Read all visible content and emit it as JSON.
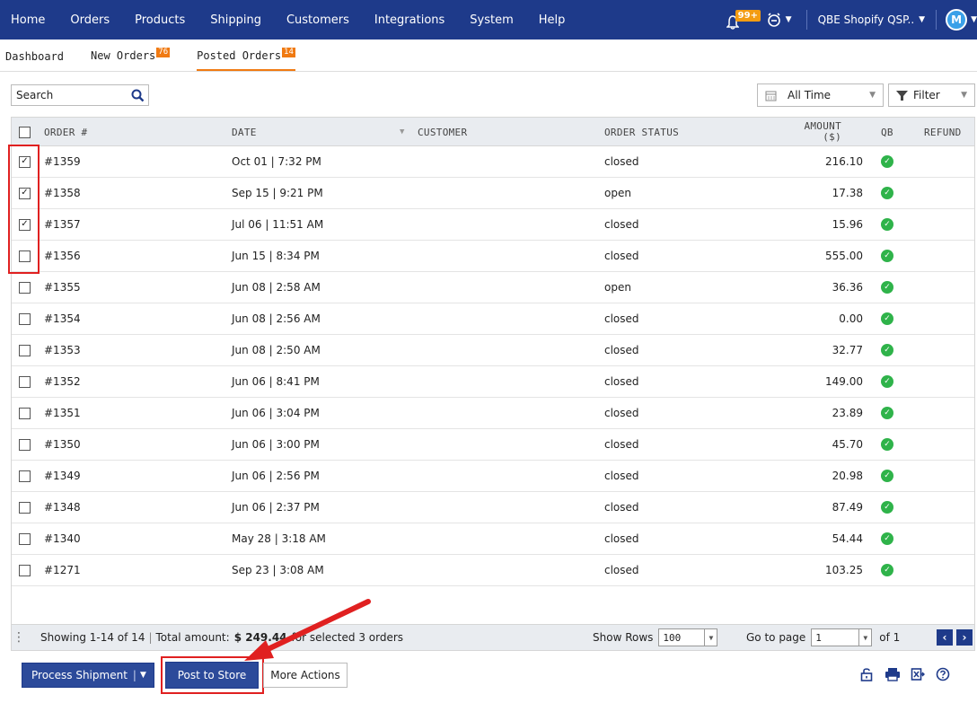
{
  "topnav": {
    "items": [
      "Home",
      "Orders",
      "Products",
      "Shipping",
      "Customers",
      "Integrations",
      "System",
      "Help"
    ],
    "notification_count": "99+",
    "store_name": "QBE Shopify QSP..",
    "avatar_initial": "M"
  },
  "subtabs": [
    {
      "label": "Dashboard",
      "count": ""
    },
    {
      "label": "New Orders",
      "count": "76"
    },
    {
      "label": "Posted Orders",
      "count": "14"
    }
  ],
  "toolbar": {
    "search_placeholder": "Search",
    "date_range": "All Time",
    "filter_label": "Filter"
  },
  "table": {
    "headers": {
      "order": "ORDER #",
      "date": "DATE",
      "customer": "CUSTOMER",
      "status": "ORDER STATUS",
      "amount_line1": "AMOUNT",
      "amount_line2": "($)",
      "qb": "QB",
      "refund": "REFUND"
    },
    "rows": [
      {
        "order": "#1359",
        "date": "Oct 01 | 7:32 PM",
        "customer": "",
        "status": "closed",
        "amount": "216.10",
        "checked": true
      },
      {
        "order": "#1358",
        "date": "Sep 15 | 9:21 PM",
        "customer": "",
        "status": "open",
        "amount": "17.38",
        "checked": true
      },
      {
        "order": "#1357",
        "date": "Jul 06 | 11:51 AM",
        "customer": "",
        "status": "closed",
        "amount": "15.96",
        "checked": true
      },
      {
        "order": "#1356",
        "date": "Jun 15 | 8:34 PM",
        "customer": "",
        "status": "closed",
        "amount": "555.00",
        "checked": false
      },
      {
        "order": "#1355",
        "date": "Jun 08 | 2:58 AM",
        "customer": "",
        "status": "open",
        "amount": "36.36",
        "checked": false
      },
      {
        "order": "#1354",
        "date": "Jun 08 | 2:56 AM",
        "customer": "",
        "status": "closed",
        "amount": "0.00",
        "checked": false
      },
      {
        "order": "#1353",
        "date": "Jun 08 | 2:50 AM",
        "customer": "",
        "status": "closed",
        "amount": "32.77",
        "checked": false
      },
      {
        "order": "#1352",
        "date": "Jun 06 | 8:41 PM",
        "customer": "",
        "status": "closed",
        "amount": "149.00",
        "checked": false
      },
      {
        "order": "#1351",
        "date": "Jun 06 | 3:04 PM",
        "customer": "",
        "status": "closed",
        "amount": "23.89",
        "checked": false
      },
      {
        "order": "#1350",
        "date": "Jun 06 | 3:00 PM",
        "customer": "",
        "status": "closed",
        "amount": "45.70",
        "checked": false
      },
      {
        "order": "#1349",
        "date": "Jun 06 | 2:56 PM",
        "customer": "",
        "status": "closed",
        "amount": "20.98",
        "checked": false
      },
      {
        "order": "#1348",
        "date": "Jun 06 | 2:37 PM",
        "customer": "",
        "status": "closed",
        "amount": "87.49",
        "checked": false
      },
      {
        "order": "#1340",
        "date": "May 28 | 3:18 AM",
        "customer": "",
        "status": "closed",
        "amount": "54.44",
        "checked": false
      },
      {
        "order": "#1271",
        "date": "Sep 23 | 3:08 AM",
        "customer": "",
        "status": "closed",
        "amount": "103.25",
        "checked": false
      }
    ]
  },
  "status_bar": {
    "showing": "Showing 1-14 of 14",
    "total_label": "Total amount:",
    "total_value": "$ 249.44",
    "selected_text": "for selected 3 orders",
    "show_rows_label": "Show Rows",
    "show_rows_value": "100",
    "go_to_page_label": "Go to page",
    "page_value": "1",
    "of_pages": "of 1"
  },
  "actions": {
    "process_shipment": "Process Shipment",
    "post_to_store": "Post to Store",
    "more_actions": "More Actions"
  },
  "colors": {
    "nav_bg": "#1e3a8a",
    "accent_orange": "#f07a12",
    "qb_green": "#2fb34a",
    "highlight_red": "#e02020"
  }
}
